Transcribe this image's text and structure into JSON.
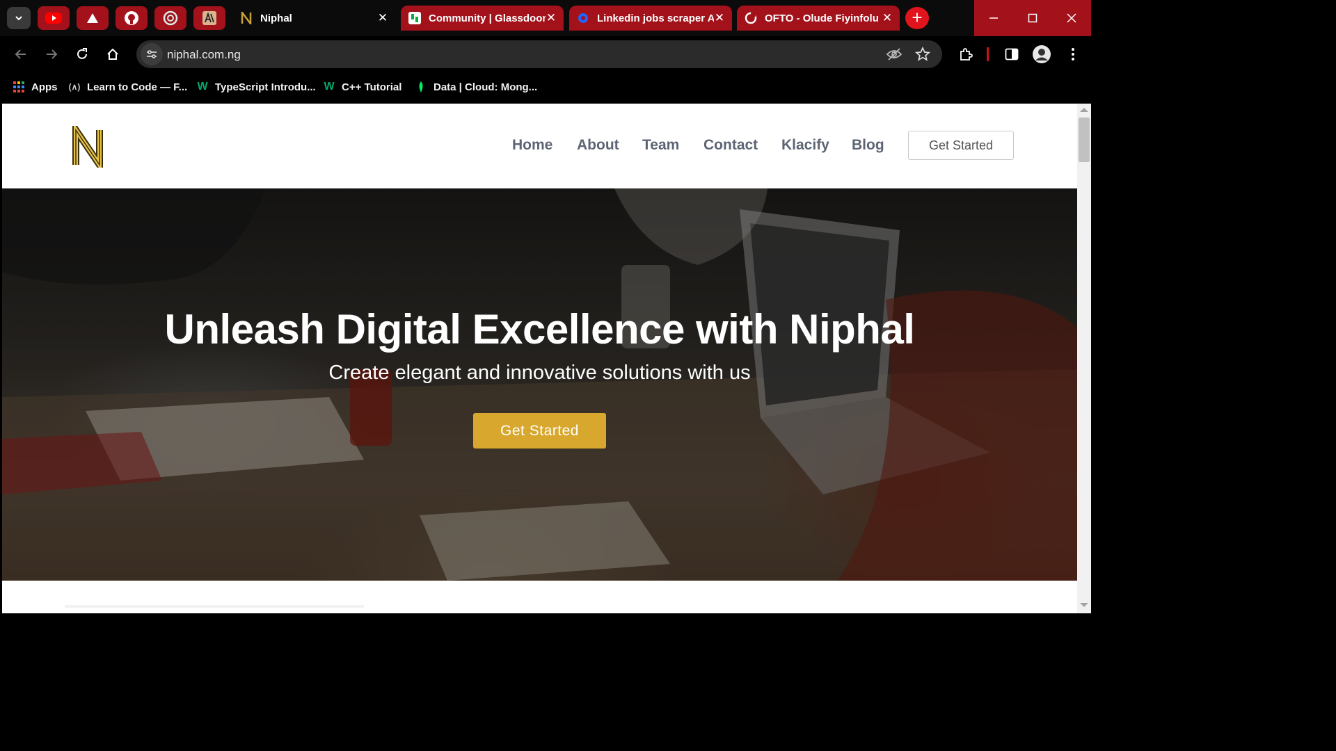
{
  "browser": {
    "pinned_tabs": [
      {
        "icon": "youtube-icon"
      },
      {
        "icon": "drive-triangle-icon"
      },
      {
        "icon": "github-icon"
      },
      {
        "icon": "openai-icon"
      },
      {
        "icon": "anthropic-icon"
      }
    ],
    "tabs": [
      {
        "title": "Niphal",
        "icon": "niphal-favicon",
        "active": true
      },
      {
        "title": "Community | Glassdoor",
        "icon": "glassdoor-favicon",
        "active": false
      },
      {
        "title": "Linkedin jobs scraper A",
        "icon": "apify-favicon",
        "active": false
      },
      {
        "title": "OFTO - Olude Fiyinfolu",
        "icon": "ofto-favicon",
        "active": false
      }
    ],
    "new_tab_label": "+",
    "url": "niphal.com.ng",
    "bookmarks": [
      {
        "label": "Apps",
        "icon": "apps-grid-icon"
      },
      {
        "label": "Learn to Code — F...",
        "icon": "freecodecamp-icon"
      },
      {
        "label": "TypeScript Introdu...",
        "icon": "w3schools-icon"
      },
      {
        "label": "C++ Tutorial",
        "icon": "w3schools-icon"
      },
      {
        "label": "Data | Cloud: Mong...",
        "icon": "mongodb-leaf-icon"
      }
    ],
    "colors": {
      "tab_accent": "#a3111b",
      "new_tab": "#e1141e"
    }
  },
  "site": {
    "nav": [
      "Home",
      "About",
      "Team",
      "Contact",
      "Klacify",
      "Blog"
    ],
    "header_cta": "Get Started",
    "hero": {
      "title": "Unleash Digital Excellence with Niphal",
      "subtitle": "Create elegant and innovative solutions with us",
      "cta": "Get Started"
    },
    "colors": {
      "accent": "#d8a72e",
      "nav_text": "#5d6473"
    }
  }
}
